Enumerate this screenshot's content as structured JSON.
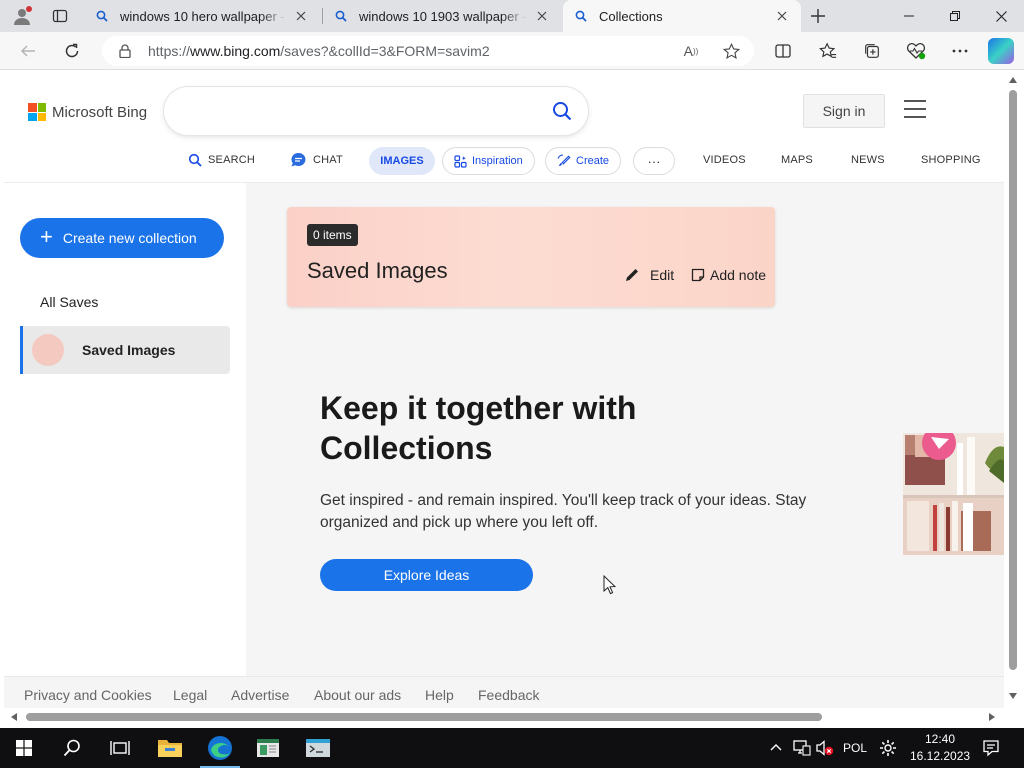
{
  "browser": {
    "tabs": [
      {
        "title": "windows 10 hero wallpaper - Search",
        "active": false
      },
      {
        "title": "windows 10 1903 wallpaper - Search",
        "active": false
      },
      {
        "title": "Collections",
        "active": true
      }
    ],
    "url_prefix": "https://",
    "url_host": "www.bing.com",
    "url_path": "/saves?&collId=3&FORM=savim2"
  },
  "header": {
    "brand": "Microsoft Bing",
    "search_placeholder": "",
    "signin_label": "Sign in"
  },
  "nav": {
    "search": "SEARCH",
    "chat": "CHAT",
    "images": "IMAGES",
    "inspiration": "Inspiration",
    "create": "Create",
    "more": "···",
    "videos": "VIDEOS",
    "maps": "MAPS",
    "news": "NEWS",
    "shopping": "SHOPPING"
  },
  "sidebar": {
    "create_label": "Create new collection",
    "all_saves": "All Saves",
    "collection": "Saved Images"
  },
  "card": {
    "count": "0 items",
    "title": "Saved Images",
    "edit": "Edit",
    "add_note": "Add note"
  },
  "promo": {
    "heading": "Keep it together with Collections",
    "body": "Get inspired - and remain inspired. You'll keep track of your ideas. Stay organized and pick up where you left off.",
    "button": "Explore Ideas"
  },
  "footer": {
    "links": [
      "Privacy and Cookies",
      "Legal",
      "Advertise",
      "About our ads",
      "Help",
      "Feedback"
    ]
  },
  "taskbar": {
    "language": "POL",
    "time": "12:40",
    "date": "16.12.2023"
  },
  "colors": {
    "accent": "#1a73e8",
    "bing_blue": "#174ae4",
    "card_bg": "#fbd0c7",
    "taskbar_bg": "#0f0f12"
  }
}
